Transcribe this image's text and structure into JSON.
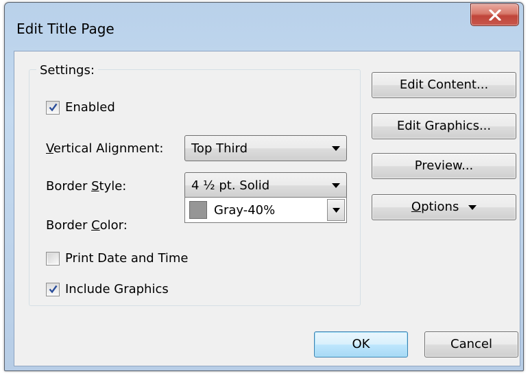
{
  "window": {
    "title": "Edit Title Page"
  },
  "settings": {
    "group_label": "Settings:",
    "enabled": {
      "label": "Enabled",
      "checked": true
    },
    "vertical_alignment": {
      "label_pre": "",
      "label_key": "V",
      "label_post": "ertical Alignment:",
      "value": "Top Third"
    },
    "border_style": {
      "label_pre": "Border ",
      "label_key": "S",
      "label_post": "tyle:",
      "value": "4 ½ pt. Solid"
    },
    "border_color": {
      "label_pre": "Border ",
      "label_key": "C",
      "label_post": "olor:",
      "value": "Gray-40%",
      "swatch": "#969696"
    },
    "print_date_time": {
      "label": "Print Date and Time",
      "checked": false
    },
    "include_graphics": {
      "label": "Include Graphics",
      "checked": true
    }
  },
  "side_buttons": {
    "edit_content": "Edit Content...",
    "edit_graphics": "Edit Graphics...",
    "preview": "Preview...",
    "options_key": "O",
    "options_rest": "ptions"
  },
  "footer": {
    "ok": "OK",
    "cancel": "Cancel"
  },
  "icons": {
    "close": "close-icon",
    "check": "checkmark-icon",
    "dropdown": "chevron-down-icon"
  },
  "colors": {
    "titlebar": "#b9d1ea",
    "close": "#c8574c",
    "dialog": "#f0f0f0",
    "default_button": "#bee6fd"
  }
}
